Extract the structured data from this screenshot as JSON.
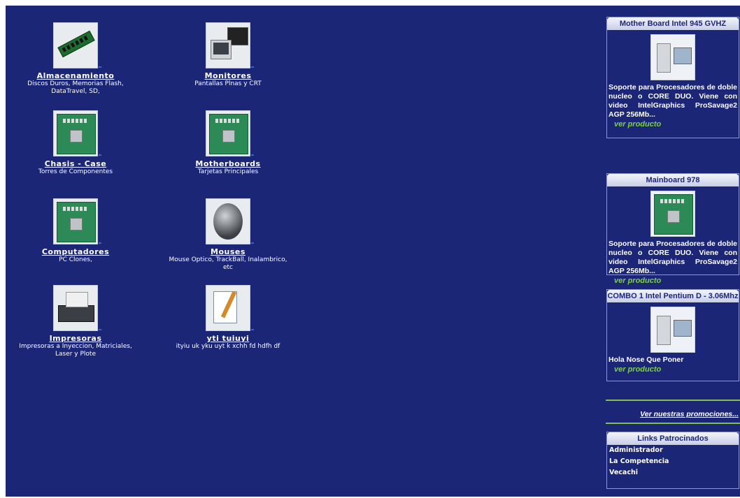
{
  "categories": [
    {
      "name": "Almacenamiento",
      "desc": "Discos Duros, Memorias Flash, DataTravel, SD,",
      "icon": "ram-icon"
    },
    {
      "name": "Monitores",
      "desc": "Pantallas Plnas y CRT",
      "icon": "monitor-icon"
    },
    {
      "name": "Chasis - Case",
      "desc": "Torres de Componentes",
      "icon": "motherboard-icon"
    },
    {
      "name": "Motherboards",
      "desc": "Tarjetas Principales",
      "icon": "motherboard-icon"
    },
    {
      "name": "Computadores",
      "desc": "PC Clones,",
      "icon": "motherboard-icon"
    },
    {
      "name": "Mouses",
      "desc": "Mouse Optico, TrackBall, Inalambrico, etc",
      "icon": "mouse-icon"
    },
    {
      "name": "Impresoras",
      "desc": "Impresoras a Inyeccion, Matriciales, Laser y Plote",
      "icon": "printer-icon"
    },
    {
      "name": "yti tuiuyi",
      "desc": "ityiu uk yku uyt k xchh fd hdfh df",
      "icon": "document-icon"
    }
  ],
  "products": [
    {
      "title": "Mother Board Intel 945 GVHZ",
      "text": "Soporte para Procesadores de doble nucleo o CORE DUO. Viene con video IntelGraphics ProSavage2 AGP 256Mb...",
      "more": "ver producto"
    },
    {
      "title": "Mainboard 978",
      "text": "Soporte para Procesadores de doble nucleo o CORE DUO. Viene con video IntelGraphics ProSavage2 AGP 256Mb...",
      "more": "ver producto"
    },
    {
      "title": "COMBO 1 Intel Pentium D - 3.06Mhz",
      "text": "Hola Nose Que Poner",
      "more": "ver producto"
    }
  ],
  "promo": "Ver nuestras promociones...",
  "links": {
    "title": "Links Patrocinados",
    "items": [
      "Administrador",
      "La Competencia",
      "Vecachi"
    ]
  },
  "colors": {
    "background": "#1c2677",
    "accent": "#7cd23c",
    "text": "#ffffff"
  }
}
